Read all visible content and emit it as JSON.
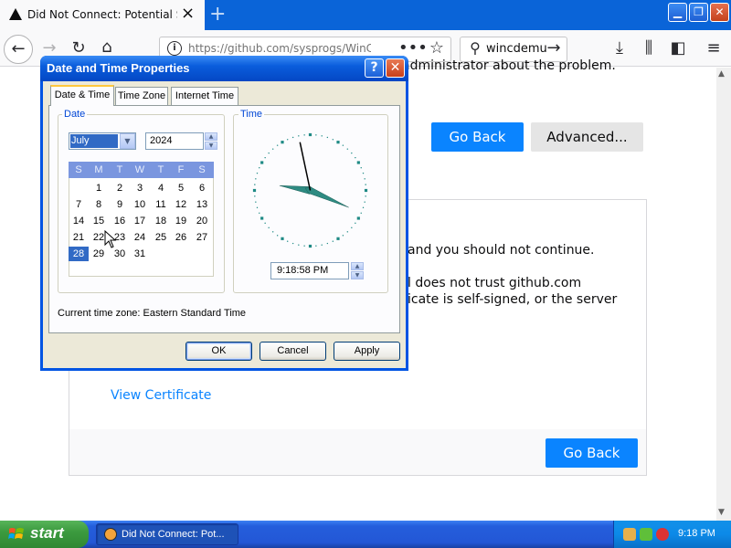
{
  "browser": {
    "tab_title": "Did Not Connect: Potential Security Issue",
    "url": "https://github.com/sysprogs/WinC",
    "search_value": "wincdemu"
  },
  "page": {
    "top_text": "administrator about the problem.",
    "go_back_label": "Go Back",
    "advanced_label": "Advanced...",
    "para1": "and you should not continue.",
    "para2": "l does not trust github.com",
    "para3": "icate is self-signed, or the server",
    "view_certificate": "View Certificate",
    "go_back_bottom_label": "Go Back"
  },
  "dialog": {
    "title": "Date and Time Properties",
    "help_label": "?",
    "close_label": "✕",
    "tabs": [
      "Date & Time",
      "Time Zone",
      "Internet Time"
    ],
    "date_group_label": "Date",
    "time_group_label": "Time",
    "month": "July",
    "year": "2024",
    "weekday_headers": [
      "S",
      "M",
      "T",
      "W",
      "T",
      "F",
      "S"
    ],
    "calendar_rows": [
      [
        "",
        "1",
        "2",
        "3",
        "4",
        "5",
        "6"
      ],
      [
        "7",
        "8",
        "9",
        "10",
        "11",
        "12",
        "13"
      ],
      [
        "14",
        "15",
        "16",
        "17",
        "18",
        "19",
        "20"
      ],
      [
        "21",
        "22",
        "23",
        "24",
        "25",
        "26",
        "27"
      ],
      [
        "28",
        "29",
        "30",
        "31",
        "",
        "",
        ""
      ]
    ],
    "selected_day": "28",
    "time": "9:18:58 PM",
    "clock": {
      "hour": 9,
      "minute": 18,
      "second": 58
    },
    "timezone_text": "Current time zone:  Eastern Standard Time",
    "ok_label": "OK",
    "cancel_label": "Cancel",
    "apply_label": "Apply"
  },
  "taskbar": {
    "start_label": "start",
    "task_label": "Did Not Connect: Pot...",
    "clock": "9:18 PM"
  },
  "colors": {
    "firefox_tabbar": "#0a64d8",
    "firefox_blue_button": "#0a84ff",
    "xp_titlebar": "#0a5ddc",
    "xp_dialog_face": "#ece9d8",
    "xp_taskbar": "#245edc",
    "xp_start_green": "#3c9b3f",
    "clock_hand": "#2e8b82"
  }
}
